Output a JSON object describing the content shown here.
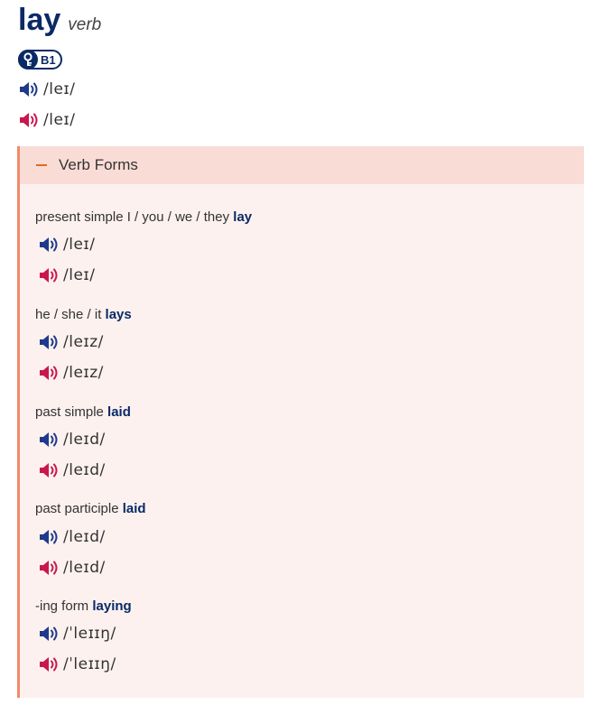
{
  "entry": {
    "headword": "lay",
    "part_of_speech": "verb",
    "level": "B1",
    "pronunciations": [
      {
        "variant": "uk",
        "icon": "speaker-uk-icon",
        "phonetic": "/leɪ/"
      },
      {
        "variant": "us",
        "icon": "speaker-us-icon",
        "phonetic": "/leɪ/"
      }
    ]
  },
  "verb_forms": {
    "title": "Verb Forms",
    "forms": [
      {
        "label": "present simple I / you / we / they",
        "form": "lay",
        "uk": "/leɪ/",
        "us": "/leɪ/"
      },
      {
        "label": "he / she / it",
        "form": "lays",
        "uk": "/leɪz/",
        "us": "/leɪz/"
      },
      {
        "label": "past simple",
        "form": "laid",
        "uk": "/leɪd/",
        "us": "/leɪd/"
      },
      {
        "label": "past participle",
        "form": "laid",
        "uk": "/leɪd/",
        "us": "/leɪd/"
      },
      {
        "label": "-ing form",
        "form": "laying",
        "uk": "/ˈleɪɪŋ/",
        "us": "/ˈleɪɪŋ/"
      }
    ]
  },
  "colors": {
    "headword": "#0a2a66",
    "uk_speaker": "#1f3a8a",
    "us_speaker": "#c8174f",
    "panel_bg": "#fcf1ef",
    "panel_header_bg": "#fadcd6",
    "panel_border": "#f08a6a",
    "toggle_minus": "#e06a1a"
  }
}
